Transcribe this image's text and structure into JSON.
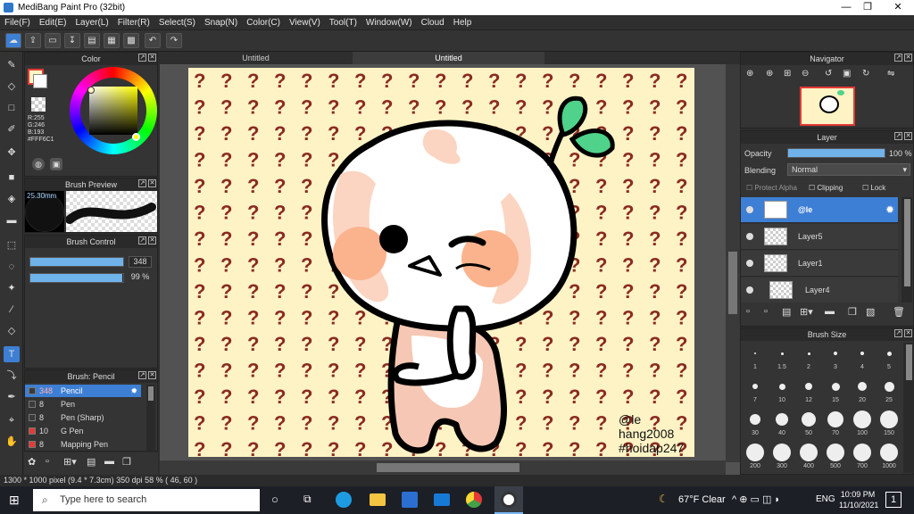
{
  "window": {
    "title": "MediBang Paint Pro (32bit)",
    "controls": [
      "—",
      "❐",
      "✕"
    ]
  },
  "menu": [
    "File(F)",
    "Edit(E)",
    "Layer(L)",
    "Filter(R)",
    "Select(S)",
    "Snap(N)",
    "Color(C)",
    "View(V)",
    "Tool(T)",
    "Window(W)",
    "Cloud",
    "Help"
  ],
  "tabs": [
    "Untitled",
    "Untitled"
  ],
  "color_panel": {
    "title": "Color",
    "r": "R:255",
    "g": "G:246",
    "b": "B:193",
    "hex": "#FFF6C1",
    "fg": "#fff6c1",
    "bg": "#ffffff"
  },
  "brush_preview": {
    "title": "Brush Preview",
    "size": "25.30mm"
  },
  "brush_control": {
    "title": "Brush Control",
    "size_value": "348",
    "opacity_value": "99 %",
    "size_level": 100,
    "opacity_level": 99
  },
  "brush_list": {
    "title": "Brush: Pencil",
    "items": [
      {
        "size": "348",
        "name": "Pencil",
        "color": "#3a3a3a"
      },
      {
        "size": "8",
        "name": "Pen",
        "color": "#3a3a3a"
      },
      {
        "size": "8",
        "name": "Pen (Sharp)",
        "color": "#3a3a3a"
      },
      {
        "size": "10",
        "name": "G Pen",
        "color": "#e53935"
      },
      {
        "size": "8",
        "name": "Mapping Pen",
        "color": "#e53935"
      }
    ]
  },
  "navigator": {
    "title": "Navigator"
  },
  "layer_panel": {
    "title": "Layer",
    "opacity_label": "Opacity",
    "opacity_value": "100 %",
    "blending_label": "Blending",
    "blending_value": "Normal",
    "protect_alpha": "Protect Alpha",
    "clipping": "Clipping",
    "lock": "Lock",
    "layers": [
      {
        "name": "@le"
      },
      {
        "name": "Layer5"
      },
      {
        "name": "Layer1"
      },
      {
        "name": "Layer4"
      }
    ]
  },
  "brush_size": {
    "title": "Brush Size",
    "sizes": [
      "1",
      "1.5",
      "2",
      "3",
      "4",
      "5",
      "7",
      "10",
      "12",
      "15",
      "20",
      "25",
      "30",
      "40",
      "50",
      "70",
      "100",
      "150",
      "200",
      "300",
      "400",
      "500",
      "700",
      "1000"
    ]
  },
  "canvas_text": {
    "line1": "@le",
    "line2": "hang2008",
    "line3": "#hoidap247",
    "pattern_char": "?"
  },
  "status": {
    "text": "1300 * 1000 pixel  (9.4 * 7.3cm)  350 dpi  58 %  ( 46, 60 )"
  },
  "taskbar": {
    "search_placeholder": "Type here to search",
    "weather": "67°F  Clear",
    "lang": "ENG",
    "time": "10:09 PM",
    "date": "11/10/2021",
    "notif_count": "1"
  }
}
